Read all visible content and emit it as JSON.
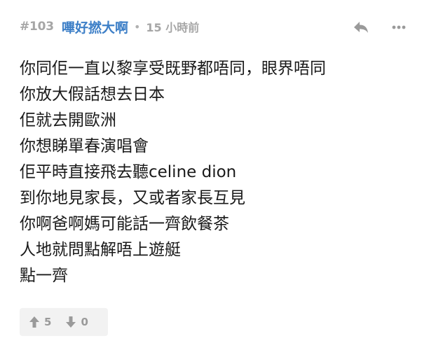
{
  "post": {
    "number": "#103",
    "username": "嗶好撚大啊",
    "separator": "•",
    "timestamp": "15 小時前",
    "lines": [
      "你同佢一直以黎享受既野都唔同，眼界唔同",
      "你放大假話想去日本",
      "佢就去開歐洲",
      "你想睇單春演唱會",
      "佢平時直接飛去聽celine dion",
      "到你地見家長，又或者家長互見",
      "你啊爸啊媽可能話一齊飲餐茶",
      "人地就問點解唔上遊艇",
      "點一齊"
    ],
    "votes": {
      "up_count": "5",
      "down_count": "0"
    }
  },
  "icons": {
    "reply": "reply-icon",
    "more": "more-icon",
    "upvote": "arrow-up-icon",
    "downvote": "arrow-down-icon"
  },
  "colors": {
    "username": "#3d7fc7",
    "meta": "#a6a6a6",
    "text": "#1a1a1a",
    "icon": "#9a9a9a",
    "vote_bg": "#f2f2f2"
  }
}
